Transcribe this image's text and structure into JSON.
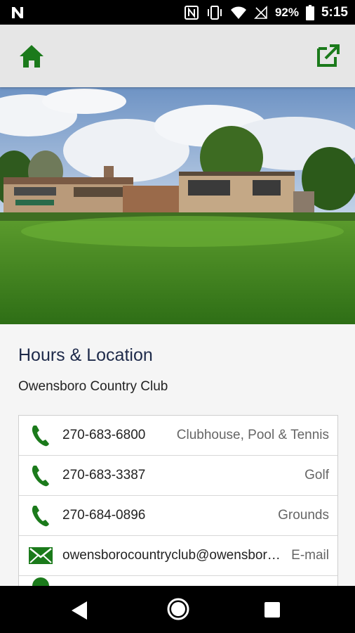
{
  "status_bar": {
    "battery_percent": "92%",
    "time": "5:15",
    "icons": [
      "n-notification-icon",
      "nfc-icon",
      "vibrate-icon",
      "wifi-icon",
      "no-signal-icon",
      "battery-icon"
    ]
  },
  "toolbar": {
    "home_icon": "home-icon",
    "external_icon": "open-external-icon",
    "accent_color": "#1b7a1b"
  },
  "hero": {
    "description_icon": "clubhouse-photo"
  },
  "section": {
    "title": "Hours & Location",
    "club_name": "Owensboro Country Club"
  },
  "contacts": [
    {
      "icon": "phone-icon",
      "value": "270-683-6800",
      "label": "Clubhouse, Pool & Tennis"
    },
    {
      "icon": "phone-icon",
      "value": "270-683-3387",
      "label": "Golf"
    },
    {
      "icon": "phone-icon",
      "value": "270-684-0896",
      "label": "Grounds"
    },
    {
      "icon": "mail-icon",
      "value": "owensborocountryclub@owensboro.com",
      "label": "E-mail"
    }
  ],
  "nav": {
    "icons": [
      "back-icon",
      "home-circle-icon",
      "recents-icon"
    ]
  }
}
